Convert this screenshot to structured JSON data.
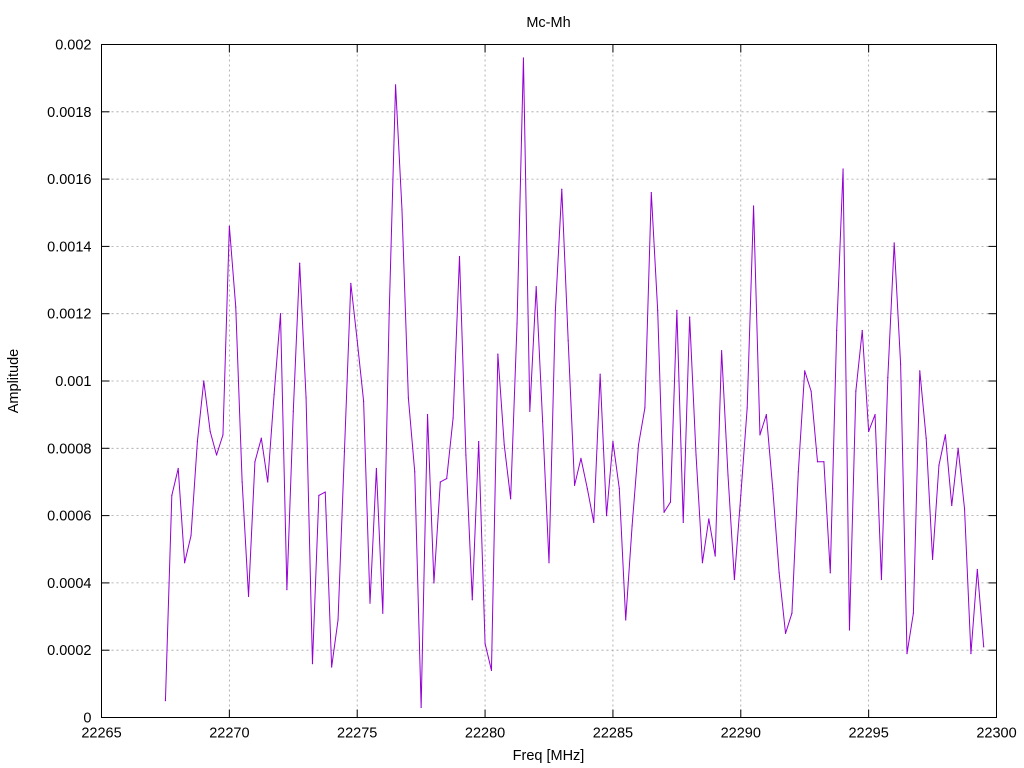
{
  "chart_data": {
    "type": "line",
    "title": "Mc-Mh",
    "xlabel": "Freq [MHz]",
    "ylabel": "Amplitude",
    "xlim": [
      22265,
      22300
    ],
    "ylim": [
      0,
      0.002
    ],
    "x_ticks": [
      22265,
      22270,
      22275,
      22280,
      22285,
      22290,
      22295,
      22300
    ],
    "x_tick_labels": [
      "22265",
      "22270",
      "22275",
      "22280",
      "22285",
      "22290",
      "22295",
      "22300"
    ],
    "y_ticks": [
      0,
      0.0002,
      0.0004,
      0.0006,
      0.0008,
      0.001,
      0.0012,
      0.0014,
      0.0016,
      0.0018,
      0.002
    ],
    "y_tick_labels": [
      "0",
      "0.0002",
      "0.0004",
      "0.0006",
      "0.0008",
      "0.001",
      "0.0012",
      "0.0014",
      "0.0016",
      "0.0018",
      "0.002"
    ],
    "grid": true,
    "legend": "none",
    "color": "#9400d3",
    "series": [
      {
        "x": [
          22267.5,
          22267.75,
          22268.0,
          22268.25,
          22268.5,
          22268.75,
          22269.0,
          22269.25,
          22269.5,
          22269.75,
          22270.0,
          22270.25,
          22270.5,
          22270.75,
          22271.0,
          22271.25,
          22271.5,
          22271.75,
          22272.0,
          22272.25,
          22272.5,
          22272.75,
          22273.0,
          22273.25,
          22273.5,
          22273.75,
          22274.0,
          22274.25,
          22274.5,
          22274.75,
          22275.0,
          22275.25,
          22275.5,
          22275.75,
          22276.0,
          22276.25,
          22276.5,
          22276.75,
          22277.0,
          22277.25,
          22277.5,
          22277.75,
          22278.0,
          22278.25,
          22278.5,
          22278.75,
          22279.0,
          22279.25,
          22279.5,
          22279.75,
          22280.0,
          22280.25,
          22280.5,
          22280.75,
          22281.0,
          22281.25,
          22281.5,
          22281.75,
          22282.0,
          22282.25,
          22282.5,
          22282.75,
          22283.0,
          22283.25,
          22283.5,
          22283.75,
          22284.0,
          22284.25,
          22284.5,
          22284.75,
          22285.0,
          22285.25,
          22285.5,
          22285.75,
          22286.0,
          22286.25,
          22286.5,
          22286.75,
          22287.0,
          22287.25,
          22287.5,
          22287.75,
          22288.0,
          22288.25,
          22288.5,
          22288.75,
          22289.0,
          22289.25,
          22289.5,
          22289.75,
          22290.0,
          22290.25,
          22290.5,
          22290.75,
          22291.0,
          22291.25,
          22291.5,
          22291.75,
          22292.0,
          22292.25,
          22292.5,
          22292.75,
          22293.0,
          22293.25,
          22293.5,
          22293.75,
          22294.0,
          22294.25,
          22294.5,
          22294.75,
          22295.0,
          22295.25,
          22295.5,
          22295.75,
          22296.0,
          22296.25,
          22296.5,
          22296.75,
          22297.0,
          22297.25,
          22297.5,
          22297.75,
          22298.0,
          22298.25,
          22298.5,
          22298.75,
          22299.0,
          22299.25,
          22299.5
        ],
        "y": [
          5e-05,
          0.00066,
          0.00074,
          0.00046,
          0.00054,
          0.00082,
          0.001,
          0.00085,
          0.00078,
          0.00084,
          0.00146,
          0.00122,
          0.0007,
          0.00036,
          0.00076,
          0.00083,
          0.0007,
          0.00096,
          0.0012,
          0.00038,
          0.00091,
          0.00135,
          0.00095,
          0.00016,
          0.00066,
          0.00067,
          0.00015,
          0.00029,
          0.00079,
          0.00129,
          0.00112,
          0.00094,
          0.00034,
          0.00074,
          0.00031,
          0.0012,
          0.00188,
          0.00151,
          0.00095,
          0.00073,
          3e-05,
          0.0009,
          0.0004,
          0.0007,
          0.00071,
          0.00089,
          0.00137,
          0.00078,
          0.00035,
          0.00082,
          0.00022,
          0.00014,
          0.00108,
          0.00081,
          0.00065,
          0.00117,
          0.00196,
          0.00091,
          0.00128,
          0.00088,
          0.00046,
          0.00121,
          0.00157,
          0.00112,
          0.00069,
          0.00077,
          0.00068,
          0.00058,
          0.00102,
          0.0006,
          0.00082,
          0.00068,
          0.00029,
          0.00057,
          0.00081,
          0.00092,
          0.00156,
          0.00121,
          0.00061,
          0.00064,
          0.00121,
          0.00058,
          0.00119,
          0.00078,
          0.00046,
          0.00059,
          0.00048,
          0.00109,
          0.00072,
          0.00041,
          0.00066,
          0.00092,
          0.00152,
          0.00084,
          0.0009,
          0.00068,
          0.00043,
          0.00025,
          0.00031,
          0.00073,
          0.00103,
          0.00097,
          0.00076,
          0.00076,
          0.00043,
          0.00115,
          0.00163,
          0.00026,
          0.00097,
          0.00115,
          0.00085,
          0.0009,
          0.00041,
          0.00101,
          0.00141,
          0.00105,
          0.00019,
          0.00031,
          0.00103,
          0.00083,
          0.00047,
          0.00075,
          0.00084,
          0.00063,
          0.0008,
          0.00062,
          0.00019,
          0.00044,
          0.00021
        ]
      }
    ]
  }
}
